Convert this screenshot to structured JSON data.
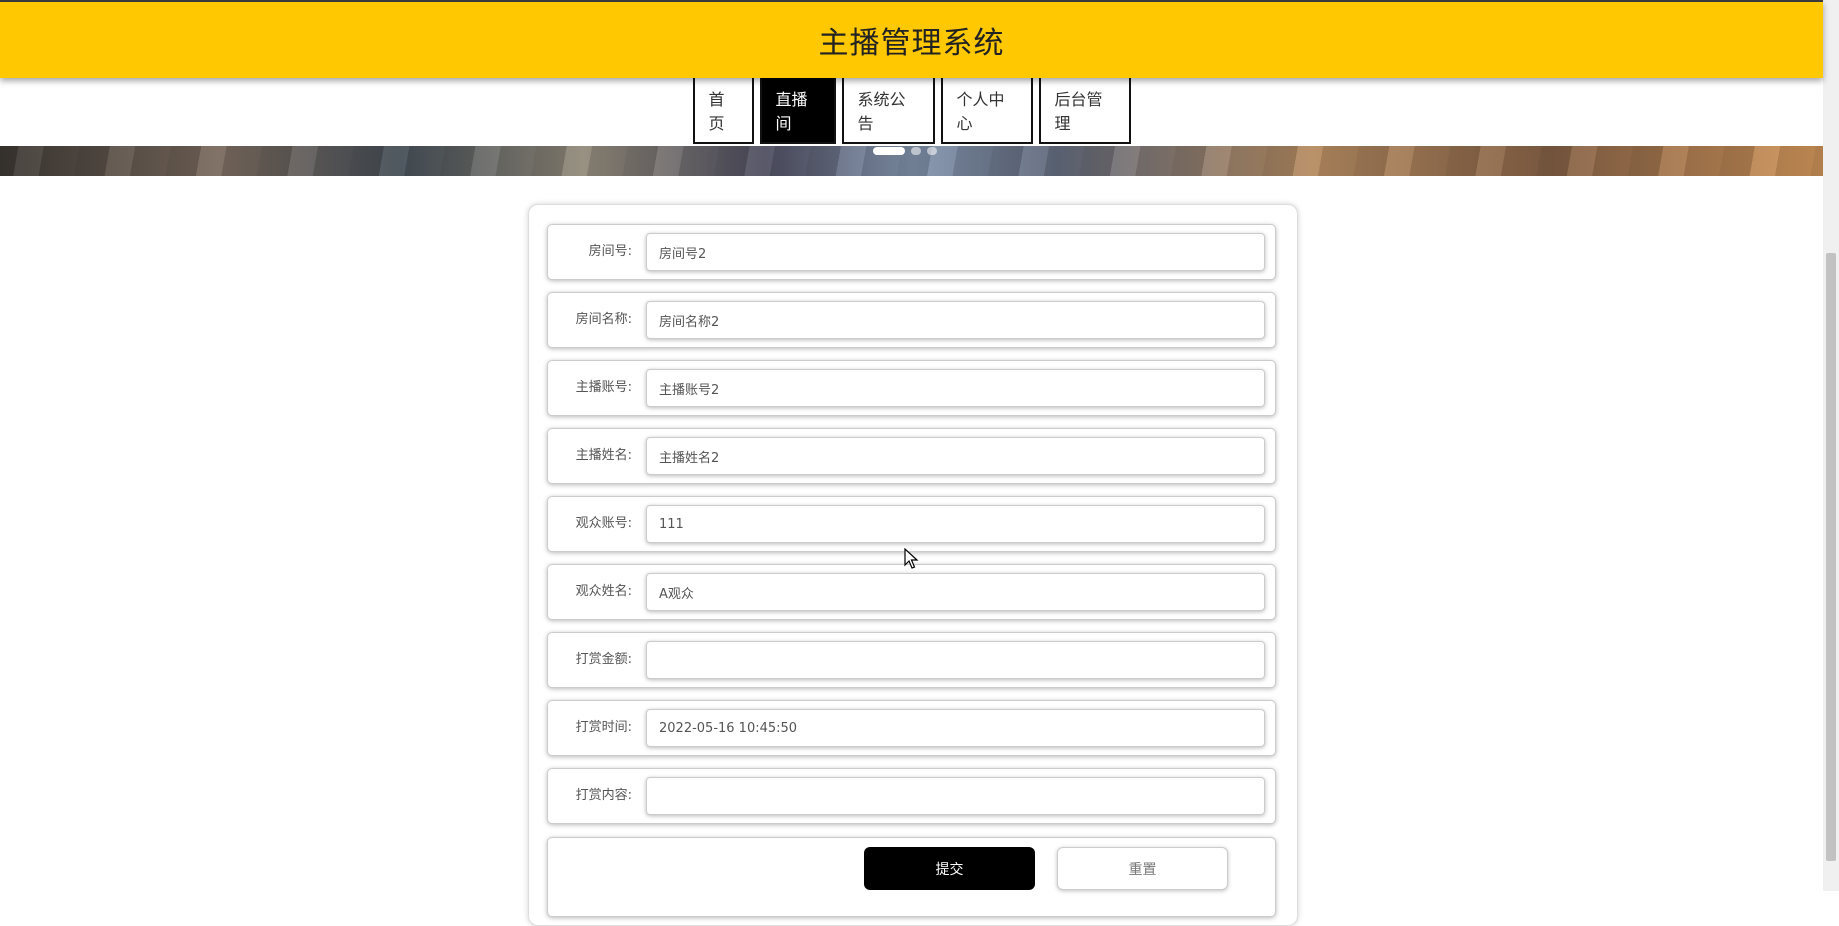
{
  "header": {
    "title": "主播管理系统"
  },
  "nav": {
    "items": [
      {
        "label": "首页"
      },
      {
        "label": "直播间"
      },
      {
        "label": "系统公告"
      },
      {
        "label": "个人中心"
      },
      {
        "label": "后台管理"
      }
    ],
    "active_label": "直播间"
  },
  "form": {
    "fields": [
      {
        "label": "房间号:",
        "value": "房间号2"
      },
      {
        "label": "房间名称:",
        "value": "房间名称2"
      },
      {
        "label": "主播账号:",
        "value": "主播账号2"
      },
      {
        "label": "主播姓名:",
        "value": "主播姓名2"
      },
      {
        "label": "观众账号:",
        "value": "111"
      },
      {
        "label": "观众姓名:",
        "value": "A观众"
      },
      {
        "label": "打赏金额:",
        "value": ""
      },
      {
        "label": "打赏时间:",
        "value": "2022-05-16 10:45:50"
      },
      {
        "label": "打赏内容:",
        "value": ""
      }
    ],
    "submit_label": "提交",
    "reset_label": "重置"
  },
  "colors": {
    "header_bg": "#ffc800",
    "active_nav_bg": "#000000",
    "submit_bg": "#000000"
  }
}
